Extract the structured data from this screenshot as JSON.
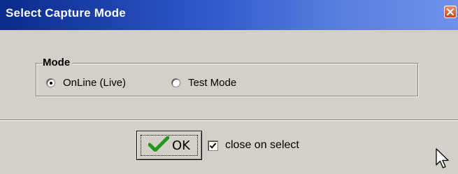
{
  "window": {
    "title": "Select Capture Mode"
  },
  "mode_group": {
    "legend": "Mode",
    "options": [
      {
        "label": "OnLine (Live)",
        "selected": true
      },
      {
        "label": "Test Mode",
        "selected": false
      }
    ]
  },
  "footer": {
    "ok_label": "OK",
    "close_on_select_label": "close on select",
    "close_on_select_checked": true
  },
  "icons": {
    "close": "close-icon",
    "ok_check": "checkmark-icon",
    "cursor": "mouse-cursor-icon"
  },
  "colors": {
    "titlebar_start": "#0a2a8c",
    "titlebar_end": "#6f90ea",
    "close_button": "#c84a24",
    "checkmark": "#1f9a1f",
    "window_bg": "#d4d0c8"
  }
}
